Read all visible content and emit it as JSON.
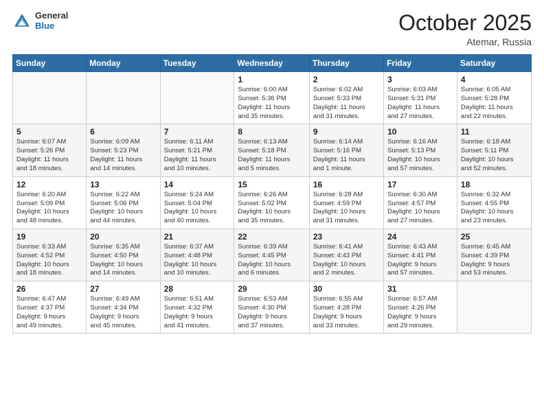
{
  "header": {
    "logo_general": "General",
    "logo_blue": "Blue",
    "month": "October 2025",
    "location": "Atemar, Russia"
  },
  "days_of_week": [
    "Sunday",
    "Monday",
    "Tuesday",
    "Wednesday",
    "Thursday",
    "Friday",
    "Saturday"
  ],
  "weeks": [
    [
      {
        "num": "",
        "info": ""
      },
      {
        "num": "",
        "info": ""
      },
      {
        "num": "",
        "info": ""
      },
      {
        "num": "1",
        "info": "Sunrise: 6:00 AM\nSunset: 5:36 PM\nDaylight: 11 hours\nand 35 minutes."
      },
      {
        "num": "2",
        "info": "Sunrise: 6:02 AM\nSunset: 5:33 PM\nDaylight: 11 hours\nand 31 minutes."
      },
      {
        "num": "3",
        "info": "Sunrise: 6:03 AM\nSunset: 5:31 PM\nDaylight: 11 hours\nand 27 minutes."
      },
      {
        "num": "4",
        "info": "Sunrise: 6:05 AM\nSunset: 5:28 PM\nDaylight: 11 hours\nand 22 minutes."
      }
    ],
    [
      {
        "num": "5",
        "info": "Sunrise: 6:07 AM\nSunset: 5:26 PM\nDaylight: 11 hours\nand 18 minutes."
      },
      {
        "num": "6",
        "info": "Sunrise: 6:09 AM\nSunset: 5:23 PM\nDaylight: 11 hours\nand 14 minutes."
      },
      {
        "num": "7",
        "info": "Sunrise: 6:11 AM\nSunset: 5:21 PM\nDaylight: 11 hours\nand 10 minutes."
      },
      {
        "num": "8",
        "info": "Sunrise: 6:13 AM\nSunset: 5:18 PM\nDaylight: 11 hours\nand 5 minutes."
      },
      {
        "num": "9",
        "info": "Sunrise: 6:14 AM\nSunset: 5:16 PM\nDaylight: 11 hours\nand 1 minute."
      },
      {
        "num": "10",
        "info": "Sunrise: 6:16 AM\nSunset: 5:13 PM\nDaylight: 10 hours\nand 57 minutes."
      },
      {
        "num": "11",
        "info": "Sunrise: 6:18 AM\nSunset: 5:11 PM\nDaylight: 10 hours\nand 52 minutes."
      }
    ],
    [
      {
        "num": "12",
        "info": "Sunrise: 6:20 AM\nSunset: 5:09 PM\nDaylight: 10 hours\nand 48 minutes."
      },
      {
        "num": "13",
        "info": "Sunrise: 6:22 AM\nSunset: 5:06 PM\nDaylight: 10 hours\nand 44 minutes."
      },
      {
        "num": "14",
        "info": "Sunrise: 6:24 AM\nSunset: 5:04 PM\nDaylight: 10 hours\nand 40 minutes."
      },
      {
        "num": "15",
        "info": "Sunrise: 6:26 AM\nSunset: 5:02 PM\nDaylight: 10 hours\nand 35 minutes."
      },
      {
        "num": "16",
        "info": "Sunrise: 6:28 AM\nSunset: 4:59 PM\nDaylight: 10 hours\nand 31 minutes."
      },
      {
        "num": "17",
        "info": "Sunrise: 6:30 AM\nSunset: 4:57 PM\nDaylight: 10 hours\nand 27 minutes."
      },
      {
        "num": "18",
        "info": "Sunrise: 6:32 AM\nSunset: 4:55 PM\nDaylight: 10 hours\nand 23 minutes."
      }
    ],
    [
      {
        "num": "19",
        "info": "Sunrise: 6:33 AM\nSunset: 4:52 PM\nDaylight: 10 hours\nand 18 minutes."
      },
      {
        "num": "20",
        "info": "Sunrise: 6:35 AM\nSunset: 4:50 PM\nDaylight: 10 hours\nand 14 minutes."
      },
      {
        "num": "21",
        "info": "Sunrise: 6:37 AM\nSunset: 4:48 PM\nDaylight: 10 hours\nand 10 minutes."
      },
      {
        "num": "22",
        "info": "Sunrise: 6:39 AM\nSunset: 4:45 PM\nDaylight: 10 hours\nand 6 minutes."
      },
      {
        "num": "23",
        "info": "Sunrise: 6:41 AM\nSunset: 4:43 PM\nDaylight: 10 hours\nand 2 minutes."
      },
      {
        "num": "24",
        "info": "Sunrise: 6:43 AM\nSunset: 4:41 PM\nDaylight: 9 hours\nand 57 minutes."
      },
      {
        "num": "25",
        "info": "Sunrise: 6:45 AM\nSunset: 4:39 PM\nDaylight: 9 hours\nand 53 minutes."
      }
    ],
    [
      {
        "num": "26",
        "info": "Sunrise: 6:47 AM\nSunset: 4:37 PM\nDaylight: 9 hours\nand 49 minutes."
      },
      {
        "num": "27",
        "info": "Sunrise: 6:49 AM\nSunset: 4:34 PM\nDaylight: 9 hours\nand 45 minutes."
      },
      {
        "num": "28",
        "info": "Sunrise: 6:51 AM\nSunset: 4:32 PM\nDaylight: 9 hours\nand 41 minutes."
      },
      {
        "num": "29",
        "info": "Sunrise: 6:53 AM\nSunset: 4:30 PM\nDaylight: 9 hours\nand 37 minutes."
      },
      {
        "num": "30",
        "info": "Sunrise: 6:55 AM\nSunset: 4:28 PM\nDaylight: 9 hours\nand 33 minutes."
      },
      {
        "num": "31",
        "info": "Sunrise: 6:57 AM\nSunset: 4:26 PM\nDaylight: 9 hours\nand 29 minutes."
      },
      {
        "num": "",
        "info": ""
      }
    ]
  ]
}
